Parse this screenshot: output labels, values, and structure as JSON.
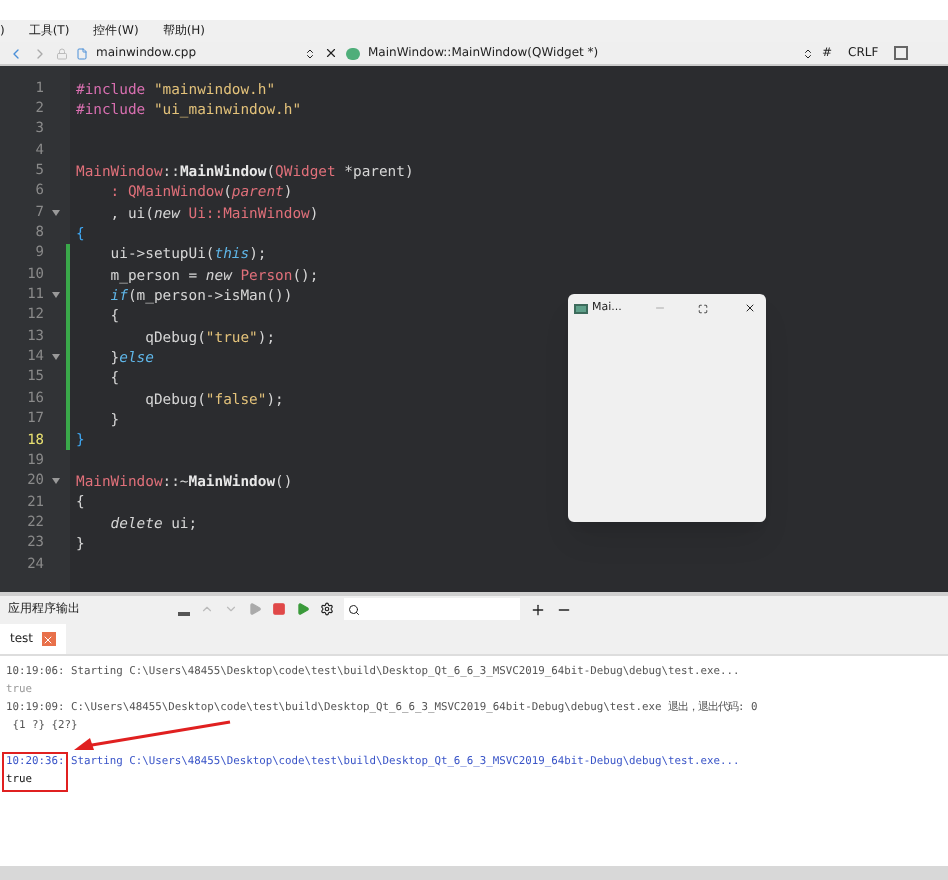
{
  "menu_bar": {
    "items": [
      ")",
      "工具(T)",
      "控件(W)",
      "帮助(H)"
    ]
  },
  "editor_toolbar": {
    "file": "mainwindow.cpp",
    "symbol": "MainWindow::MainWindow(QWidget *)",
    "hash": "#",
    "line_ending": "CRLF"
  },
  "editor": {
    "lines": [
      {
        "number": "1",
        "tokens": [
          {
            "kind": "macro",
            "text": "#include "
          },
          {
            "kind": "string",
            "text": "\"mainwindow.h\""
          }
        ]
      },
      {
        "number": "2",
        "tokens": [
          {
            "kind": "macro",
            "text": "#include "
          },
          {
            "kind": "string",
            "text": "\"ui_mainwindow.h\""
          }
        ]
      },
      {
        "number": "3"
      },
      {
        "number": "4"
      },
      {
        "number": "5",
        "tokens": [
          {
            "kind": "type",
            "text": "MainWindow"
          },
          {
            "kind": "plain",
            "text": "::"
          },
          {
            "kind": "fn",
            "text": "MainWindow"
          },
          {
            "kind": "plain",
            "text": "("
          },
          {
            "kind": "type",
            "text": "QWidget"
          },
          {
            "kind": "plain",
            "text": " *parent)"
          }
        ]
      },
      {
        "number": "6",
        "tokens": [
          {
            "kind": "type",
            "text": "    : QMainWindow"
          },
          {
            "kind": "plain",
            "text": "("
          },
          {
            "kind": "param",
            "text": "parent"
          },
          {
            "kind": "plain",
            "text": ")"
          }
        ]
      },
      {
        "number": "7",
        "fold": true,
        "tokens": [
          {
            "kind": "plain",
            "text": "    , ui("
          },
          {
            "kind": "keyword",
            "text": "new"
          },
          {
            "kind": "type",
            "text": " Ui::MainWindow"
          },
          {
            "kind": "plain",
            "text": ")"
          }
        ]
      },
      {
        "number": "8",
        "tokens": [
          {
            "kind": "brace",
            "text": "{"
          }
        ]
      },
      {
        "number": "9",
        "modified": true,
        "tokens": [
          {
            "kind": "plain",
            "text": "    ui->setupUi("
          },
          {
            "kind": "this",
            "text": "this"
          },
          {
            "kind": "plain",
            "text": ");"
          }
        ]
      },
      {
        "number": "10",
        "modified": true,
        "tokens": [
          {
            "kind": "plain",
            "text": "    m_person = "
          },
          {
            "kind": "keyword",
            "text": "new"
          },
          {
            "kind": "type",
            "text": " Person"
          },
          {
            "kind": "plain",
            "text": "();"
          }
        ]
      },
      {
        "number": "11",
        "modified": true,
        "fold": true,
        "tokens": [
          {
            "kind": "this",
            "text": "    if"
          },
          {
            "kind": "plain",
            "text": "(m_person->isMan())"
          }
        ]
      },
      {
        "number": "12",
        "modified": true,
        "tokens": [
          {
            "kind": "plain",
            "text": "    {"
          }
        ]
      },
      {
        "number": "13",
        "modified": true,
        "tokens": [
          {
            "kind": "plain",
            "text": "        qDebug("
          },
          {
            "kind": "string",
            "text": "\"true\""
          },
          {
            "kind": "plain",
            "text": ");"
          }
        ]
      },
      {
        "number": "14",
        "modified": true,
        "fold": true,
        "tokens": [
          {
            "kind": "plain",
            "text": "    }"
          },
          {
            "kind": "this",
            "text": "else"
          }
        ]
      },
      {
        "number": "15",
        "modified": true,
        "tokens": [
          {
            "kind": "plain",
            "text": "    {"
          }
        ]
      },
      {
        "number": "16",
        "modified": true,
        "tokens": [
          {
            "kind": "plain",
            "text": "        qDebug("
          },
          {
            "kind": "string",
            "text": "\"false\""
          },
          {
            "kind": "plain",
            "text": ");"
          }
        ]
      },
      {
        "number": "17",
        "modified": true,
        "tokens": [
          {
            "kind": "plain",
            "text": "    }"
          }
        ]
      },
      {
        "number": "18",
        "modified": true,
        "current": true,
        "tokens": [
          {
            "kind": "brace",
            "text": "}"
          }
        ]
      },
      {
        "number": "19"
      },
      {
        "number": "20",
        "fold": true,
        "tokens": [
          {
            "kind": "type",
            "text": "MainWindow"
          },
          {
            "kind": "plain",
            "text": "::~"
          },
          {
            "kind": "fn",
            "text": "MainWindow"
          },
          {
            "kind": "plain",
            "text": "()"
          }
        ]
      },
      {
        "number": "21",
        "tokens": [
          {
            "kind": "plain",
            "text": "{"
          }
        ]
      },
      {
        "number": "22",
        "tokens": [
          {
            "kind": "keyword",
            "text": "    delete"
          },
          {
            "kind": "plain",
            "text": " ui;"
          }
        ]
      },
      {
        "number": "23",
        "tokens": [
          {
            "kind": "plain",
            "text": "}"
          }
        ]
      },
      {
        "number": "24"
      }
    ]
  },
  "app_window": {
    "title": "Mai..."
  },
  "output_pane": {
    "title": "应用程序输出",
    "tabs": [
      {
        "label": "test",
        "selected": true
      }
    ],
    "lines": [
      {
        "kind": "system",
        "faded": true,
        "text": "10:19:06: Starting C:\\Users\\48455\\Desktop\\code\\test\\build\\Desktop_Qt_6_6_3_MSVC2019_64bit-Debug\\debug\\test.exe..."
      },
      {
        "kind": "output",
        "faded": true,
        "text": "true"
      },
      {
        "kind": "system",
        "faded": true,
        "text": "10:19:09: C:\\Users\\48455\\Desktop\\code\\test\\build\\Desktop_Qt_6_6_3_MSVC2019_64bit-Debug\\debug\\test.exe 退出，退出代码: 0"
      },
      {
        "kind": "system",
        "faded": true,
        "text": " {1 ?} {2?}"
      },
      {
        "kind": "system",
        "faded": false,
        "highlight": true,
        "text": "10:20:36: Starting C:\\Users\\48455\\Desktop\\code\\test\\build\\Desktop_Qt_6_6_3_MSVC2019_64bit-Debug\\debug\\test.exe..."
      },
      {
        "kind": "output",
        "faded": false,
        "highlight": true,
        "text": "true"
      }
    ]
  }
}
